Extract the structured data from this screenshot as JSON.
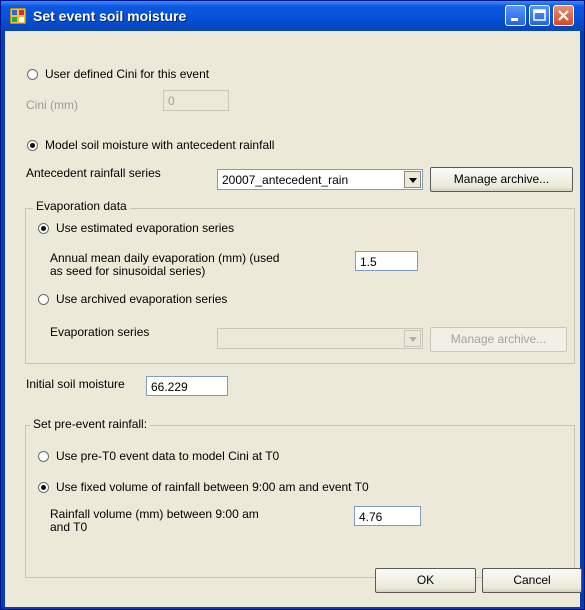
{
  "window": {
    "title": "Set event soil moisture"
  },
  "user_defined": {
    "radio_label": "User defined Cini for this event",
    "selected": false,
    "cini_label": "Cini (mm)",
    "cini_value": "0"
  },
  "model": {
    "radio_label": "Model soil moisture with antecedent rainfall",
    "selected": true,
    "antecedent_label": "Antecedent rainfall series",
    "antecedent_value": "20007_antecedent_rain",
    "manage_archive_label": "Manage archive..."
  },
  "evaporation": {
    "group_title": "Evaporation data",
    "estimated_label": "Use estimated evaporation series",
    "annual_label_1": "Annual mean daily evaporation (mm) (used",
    "annual_label_2": "as seed for sinusoidal series)",
    "annual_value": "1.5",
    "archived_label": "Use archived evaporation series",
    "series_label": "Evaporation series",
    "series_value": "",
    "manage_archive_label": "Manage archive..."
  },
  "initial_soil_moisture": {
    "label": "Initial soil moisture",
    "value": "66.229"
  },
  "pre_event": {
    "group_title": "Set pre-event rainfall:",
    "option1_label": "Use pre-T0 event data to model Cini at T0",
    "option2_label": "Use fixed volume of rainfall between 9:00 am and event T0",
    "volume_label_1": "Rainfall volume (mm) between 9:00 am",
    "volume_label_2": "and T0",
    "volume_value": "4.76"
  },
  "buttons": {
    "ok": "OK",
    "cancel": "Cancel"
  }
}
